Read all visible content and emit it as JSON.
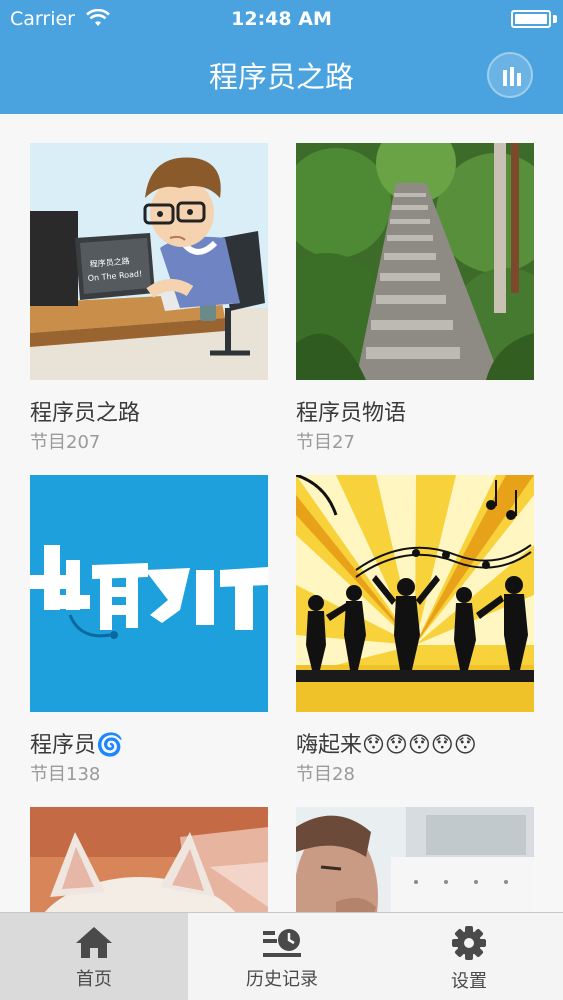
{
  "status_bar": {
    "carrier": "Carrier",
    "time": "12:48 AM",
    "battery_level": 1.0
  },
  "nav": {
    "title": "程序员之路",
    "right_icon": "bars-icon"
  },
  "cards": [
    {
      "title": "程序员之路",
      "subtitle": "节目207",
      "image": "cartoon-programmer-at-computer",
      "image_text": "程序员之路 On The Road!"
    },
    {
      "title": "程序员物语",
      "subtitle": "节目27",
      "image": "stone-stairway-in-forest"
    },
    {
      "title": "程序员🌀",
      "subtitle": "节目138",
      "image": "blue-qu-it-logo",
      "image_text": "趣IT"
    },
    {
      "title": "嗨起来😯😯😯😯😯",
      "subtitle": "节目28",
      "image": "dancing-silhouettes-music-notes"
    },
    {
      "title": "",
      "subtitle": "",
      "image": "white-cat-on-bed"
    },
    {
      "title": "",
      "subtitle": "",
      "image": "man-with-hand-on-chin"
    }
  ],
  "tabs": [
    {
      "label": "首页",
      "icon": "home-icon",
      "active": true
    },
    {
      "label": "历史记录",
      "icon": "history-icon",
      "active": false
    },
    {
      "label": "设置",
      "icon": "gear-icon",
      "active": false
    }
  ],
  "colors": {
    "header": "#4aa3df",
    "tab_active": "#dadada",
    "tabbar": "#f4f4f4"
  }
}
